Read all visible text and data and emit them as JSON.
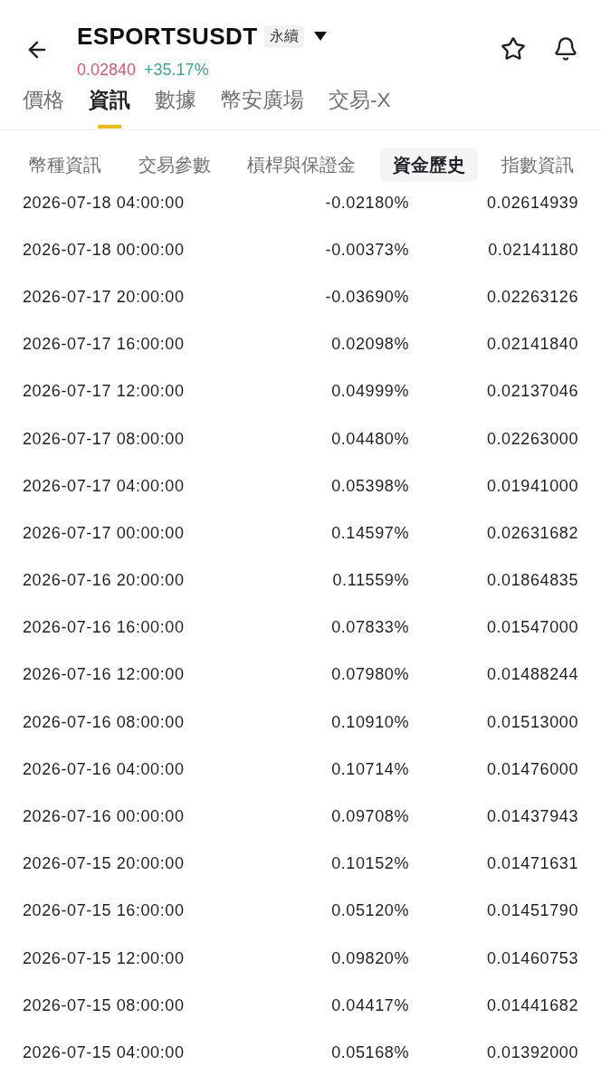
{
  "header": {
    "symbol": "ESPORTSUSDT",
    "contract_badge": "永續",
    "price": "0.02840",
    "change": "+35.17%"
  },
  "tabs": [
    {
      "label": "價格",
      "selected": false
    },
    {
      "label": "資訊",
      "selected": true
    },
    {
      "label": "數據",
      "selected": false
    },
    {
      "label": "幣安廣場",
      "selected": false
    },
    {
      "label": "交易-X",
      "selected": false
    }
  ],
  "sub_tabs": [
    {
      "label": "幣種資訊",
      "selected": false
    },
    {
      "label": "交易參數",
      "selected": false
    },
    {
      "label": "槓桿與保證金",
      "selected": false
    },
    {
      "label": "資金歷史",
      "selected": true
    },
    {
      "label": "指數資訊",
      "selected": false
    }
  ],
  "funding_history": {
    "rows": [
      {
        "time": "2026-07-18 04:00:00",
        "rate": "-0.02180%",
        "price": "0.02614939"
      },
      {
        "time": "2026-07-18 00:00:00",
        "rate": "-0.00373%",
        "price": "0.02141180"
      },
      {
        "time": "2026-07-17 20:00:00",
        "rate": "-0.03690%",
        "price": "0.02263126"
      },
      {
        "time": "2026-07-17 16:00:00",
        "rate": "0.02098%",
        "price": "0.02141840"
      },
      {
        "time": "2026-07-17 12:00:00",
        "rate": "0.04999%",
        "price": "0.02137046"
      },
      {
        "time": "2026-07-17 08:00:00",
        "rate": "0.04480%",
        "price": "0.02263000"
      },
      {
        "time": "2026-07-17 04:00:00",
        "rate": "0.05398%",
        "price": "0.01941000"
      },
      {
        "time": "2026-07-17 00:00:00",
        "rate": "0.14597%",
        "price": "0.02631682"
      },
      {
        "time": "2026-07-16 20:00:00",
        "rate": "0.11559%",
        "price": "0.01864835"
      },
      {
        "time": "2026-07-16 16:00:00",
        "rate": "0.07833%",
        "price": "0.01547000"
      },
      {
        "time": "2026-07-16 12:00:00",
        "rate": "0.07980%",
        "price": "0.01488244"
      },
      {
        "time": "2026-07-16 08:00:00",
        "rate": "0.10910%",
        "price": "0.01513000"
      },
      {
        "time": "2026-07-16 04:00:00",
        "rate": "0.10714%",
        "price": "0.01476000"
      },
      {
        "time": "2026-07-16 00:00:00",
        "rate": "0.09708%",
        "price": "0.01437943"
      },
      {
        "time": "2026-07-15 20:00:00",
        "rate": "0.10152%",
        "price": "0.01471631"
      },
      {
        "time": "2026-07-15 16:00:00",
        "rate": "0.05120%",
        "price": "0.01451790"
      },
      {
        "time": "2026-07-15 12:00:00",
        "rate": "0.09820%",
        "price": "0.01460753"
      },
      {
        "time": "2026-07-15 08:00:00",
        "rate": "0.04417%",
        "price": "0.01441682"
      },
      {
        "time": "2026-07-15 04:00:00",
        "rate": "0.05168%",
        "price": "0.01392000"
      }
    ]
  }
}
